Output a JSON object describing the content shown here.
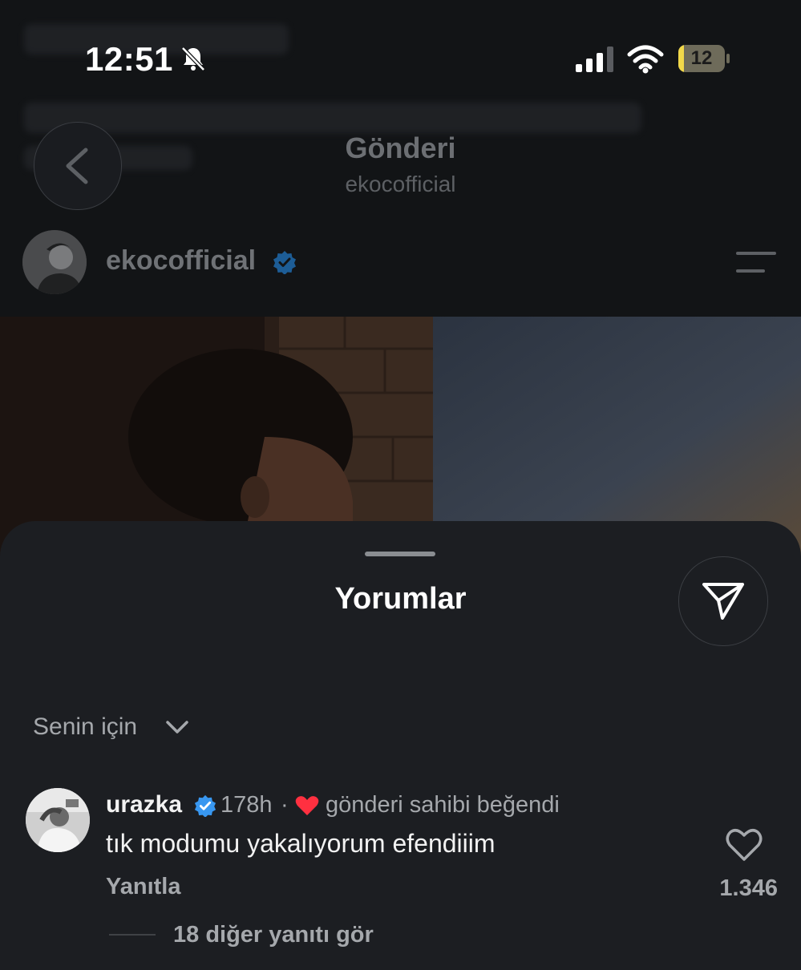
{
  "status_bar": {
    "time": "12:51",
    "battery": "12",
    "battery_level_percent": 12,
    "icons": [
      "bell-slash-icon",
      "cellular-signal-icon",
      "wifi-icon",
      "battery-icon"
    ]
  },
  "header": {
    "title": "Gönderi",
    "subtitle": "ekocofficial",
    "back_icon": "chevron-left-icon"
  },
  "post": {
    "username": "ekocofficial",
    "verified": true,
    "menu_icon": "menu-icon"
  },
  "comments_sheet": {
    "title": "Yorumlar",
    "share_icon": "send-icon",
    "filter_label": "Senin için",
    "comment": {
      "username": "urazka",
      "verified": true,
      "time": "178h",
      "separator": "·",
      "owner_liked": "gönderi sahibi beğendi",
      "text": "tık modumu yakalıyorum efendiiim",
      "reply_label": "Yanıtla",
      "like_count": "1.346",
      "more_replies": "18 diğer yanıtı gör"
    }
  },
  "colors": {
    "sheet_bg": "#1c1e22",
    "verified_blue": "#3897f0",
    "heart_red": "#ff3040",
    "muted_text": "#a5a8ac"
  }
}
